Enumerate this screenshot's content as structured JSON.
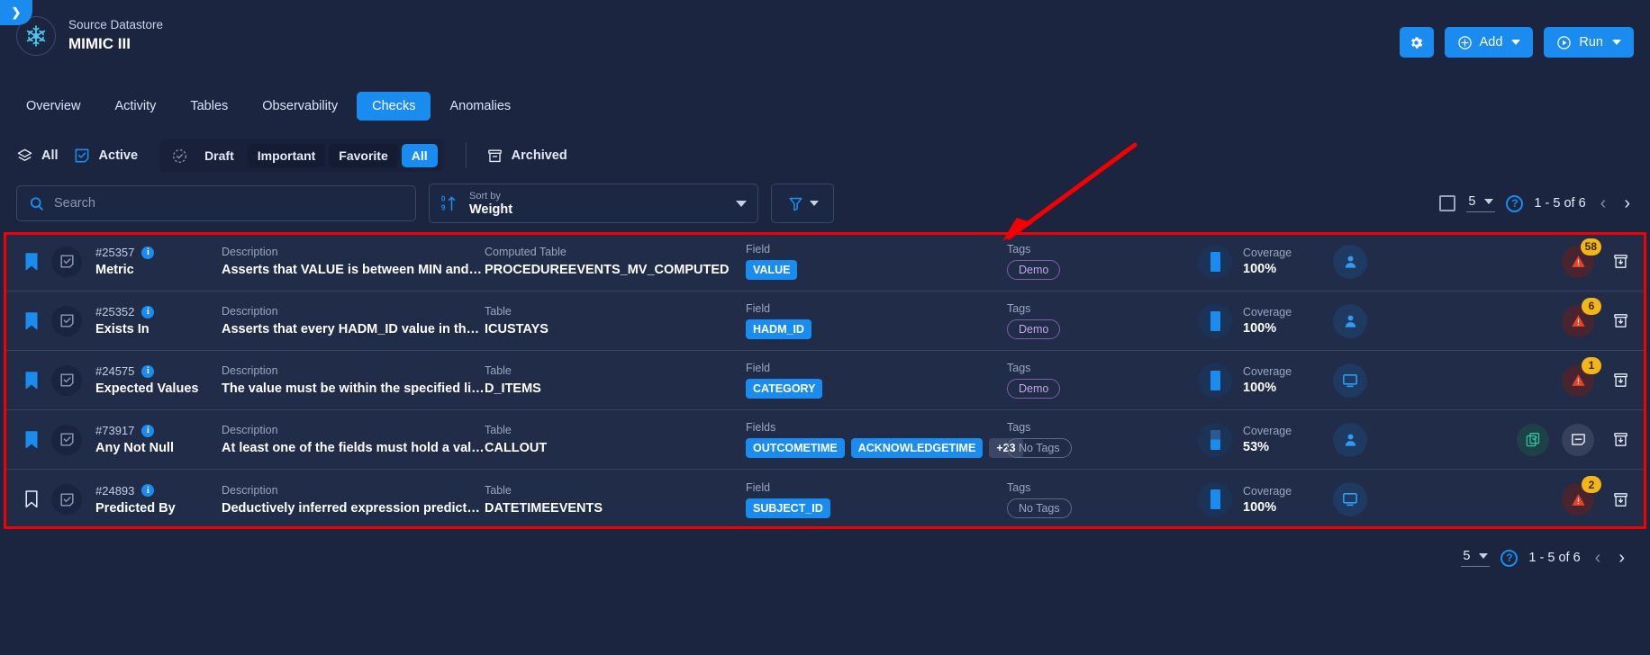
{
  "sidebar_toggle": {
    "icon": "chevron-right-icon"
  },
  "header": {
    "datastore_label": "Source Datastore",
    "datastore_name": "MIMIC III",
    "avatar_icon": "snowflake-icon",
    "actions": {
      "settings_icon": "gear-icon",
      "add_label": "Add",
      "add_icon": "plus-circle-icon",
      "run_label": "Run",
      "run_icon": "play-circle-icon"
    }
  },
  "nav": {
    "tabs": [
      {
        "label": "Overview",
        "active": false
      },
      {
        "label": "Activity",
        "active": false
      },
      {
        "label": "Tables",
        "active": false
      },
      {
        "label": "Observability",
        "active": false
      },
      {
        "label": "Checks",
        "active": true
      },
      {
        "label": "Anomalies",
        "active": false
      }
    ]
  },
  "filters": {
    "all": {
      "label": "All",
      "icon": "layers-icon"
    },
    "active": {
      "label": "Active",
      "icon": "check-square-icon"
    },
    "status_group": [
      {
        "label": "Draft",
        "style": "plain",
        "icon": "dashed-check-icon"
      },
      {
        "label": "Important",
        "style": "boxed"
      },
      {
        "label": "Favorite",
        "style": "boxed"
      },
      {
        "label": "All",
        "style": "active"
      }
    ],
    "archived": {
      "label": "Archived",
      "icon": "archive-box-icon"
    }
  },
  "search": {
    "placeholder": "Search",
    "value": "",
    "icon": "search-icon"
  },
  "sort": {
    "label": "Sort by",
    "value": "Weight",
    "icon": "sort-numeric-icon"
  },
  "filter_button": {
    "icon": "funnel-icon"
  },
  "pagination_top": {
    "select_all_icon": "checkbox-empty-icon",
    "page_size": "5",
    "help_icon": "question-circle-icon",
    "range": "1 - 5 of 6",
    "prev": "‹",
    "next": "›"
  },
  "pagination_bottom": {
    "page_size": "5",
    "help_icon": "question-circle-icon",
    "range": "1 - 5 of 6",
    "prev": "‹",
    "next": "›"
  },
  "labels": {
    "description": "Description",
    "tags": "Tags",
    "coverage": "Coverage"
  },
  "annotation": {
    "type": "red-arrow",
    "color": "#f50000"
  },
  "highlight": {
    "color": "#f50000"
  },
  "rows": [
    {
      "bookmarked": true,
      "id": "#25357",
      "type": "Metric",
      "desc_label": "Description",
      "description": "Asserts that VALUE is between MIN and MAX",
      "table_label": "Computed Table",
      "table": "PROCEDUREEVENTS_MV_COMPUTED",
      "field_label": "Field",
      "fields": [
        "VALUE"
      ],
      "more_fields": "",
      "tags_label": "Tags",
      "tags": [
        "Demo"
      ],
      "coverage_label": "Coverage",
      "coverage": "100%",
      "coverage_pct": 100,
      "owner_icon": "user-icon",
      "actions": [],
      "alert_count": "58",
      "archive_icon": "archive-download-icon"
    },
    {
      "bookmarked": true,
      "id": "#25352",
      "type": "Exists In",
      "desc_label": "Description",
      "description": "Asserts that every HADM_ID value in the ICUS…",
      "table_label": "Table",
      "table": "ICUSTAYS",
      "field_label": "Field",
      "fields": [
        "HADM_ID"
      ],
      "more_fields": "",
      "tags_label": "Tags",
      "tags": [
        "Demo"
      ],
      "coverage_label": "Coverage",
      "coverage": "100%",
      "coverage_pct": 100,
      "owner_icon": "user-icon",
      "actions": [],
      "alert_count": "6",
      "archive_icon": "archive-download-icon"
    },
    {
      "bookmarked": true,
      "id": "#24575",
      "type": "Expected Values",
      "desc_label": "Description",
      "description": "The value must be within the specified list of v…",
      "table_label": "Table",
      "table": "D_ITEMS",
      "field_label": "Field",
      "fields": [
        "CATEGORY"
      ],
      "more_fields": "",
      "tags_label": "Tags",
      "tags": [
        "Demo"
      ],
      "coverage_label": "Coverage",
      "coverage": "100%",
      "coverage_pct": 100,
      "owner_icon": "monitor-icon",
      "actions": [],
      "alert_count": "1",
      "archive_icon": "archive-download-icon"
    },
    {
      "bookmarked": true,
      "id": "#73917",
      "type": "Any Not Null",
      "desc_label": "Description",
      "description": "At least one of the fields must hold a value",
      "table_label": "Table",
      "table": "CALLOUT",
      "field_label": "Fields",
      "fields": [
        "OUTCOMETIME",
        "ACKNOWLEDGETIME"
      ],
      "more_fields": "+23",
      "tags_label": "Tags",
      "tags": [
        "No Tags"
      ],
      "coverage_label": "Coverage",
      "coverage": "53%",
      "coverage_pct": 53,
      "owner_icon": "user-icon",
      "actions": [
        "clipboard-check-icon",
        "comment-icon"
      ],
      "alert_count": "",
      "archive_icon": "archive-download-icon"
    },
    {
      "bookmarked": false,
      "id": "#24893",
      "type": "Predicted By",
      "desc_label": "Description",
      "description": "Deductively inferred expression predicts a val…",
      "table_label": "Table",
      "table": "DATETIMEEVENTS",
      "field_label": "Field",
      "fields": [
        "SUBJECT_ID"
      ],
      "more_fields": "",
      "tags_label": "Tags",
      "tags": [
        "No Tags"
      ],
      "coverage_label": "Coverage",
      "coverage": "100%",
      "coverage_pct": 100,
      "owner_icon": "monitor-icon",
      "actions": [],
      "alert_count": "2",
      "archive_icon": "archive-download-icon"
    }
  ],
  "colors": {
    "accent": "#1a8cf0",
    "background": "#1b2540",
    "row_background": "#212c49",
    "alert_badge": "#f3b519",
    "alert_triangle": "#ef4023",
    "tag_purple": "#c3a8e8",
    "highlight_red": "#f50000"
  }
}
